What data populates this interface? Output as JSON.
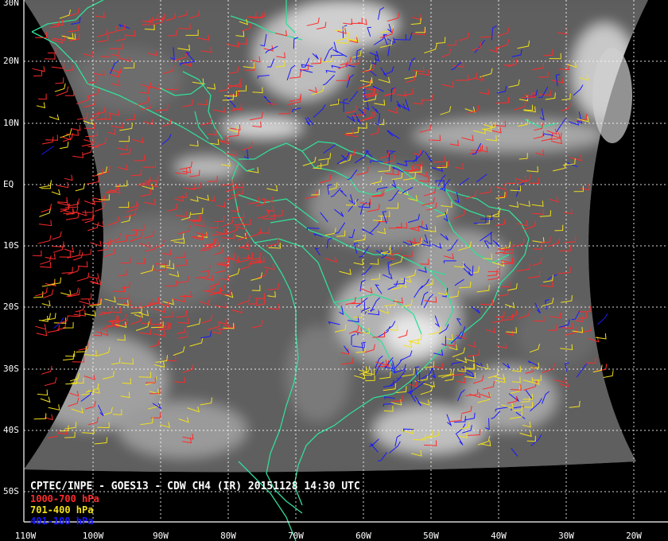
{
  "caption": "CPTEC/INPE - GOES13 - CDW CH4 (IR) 20151128 14:30 UTC",
  "legend": [
    {
      "label": "1000-700 hPa",
      "color": "#ff2a2a"
    },
    {
      "label": "701-400 hPa",
      "color": "#f2e01a"
    },
    {
      "label": "401-100 hPa",
      "color": "#1a1aff"
    }
  ],
  "lat_labels": [
    "30N",
    "20N",
    "10N",
    "EQ",
    "10S",
    "20S",
    "30S",
    "40S",
    "50S"
  ],
  "lon_labels": [
    "110W",
    "100W",
    "90W",
    "80W",
    "70W",
    "60W",
    "50W",
    "40W",
    "30W",
    "20W"
  ],
  "colors": {
    "coast": "#33dd99",
    "grid": "#ffffff",
    "background": "#000000"
  }
}
